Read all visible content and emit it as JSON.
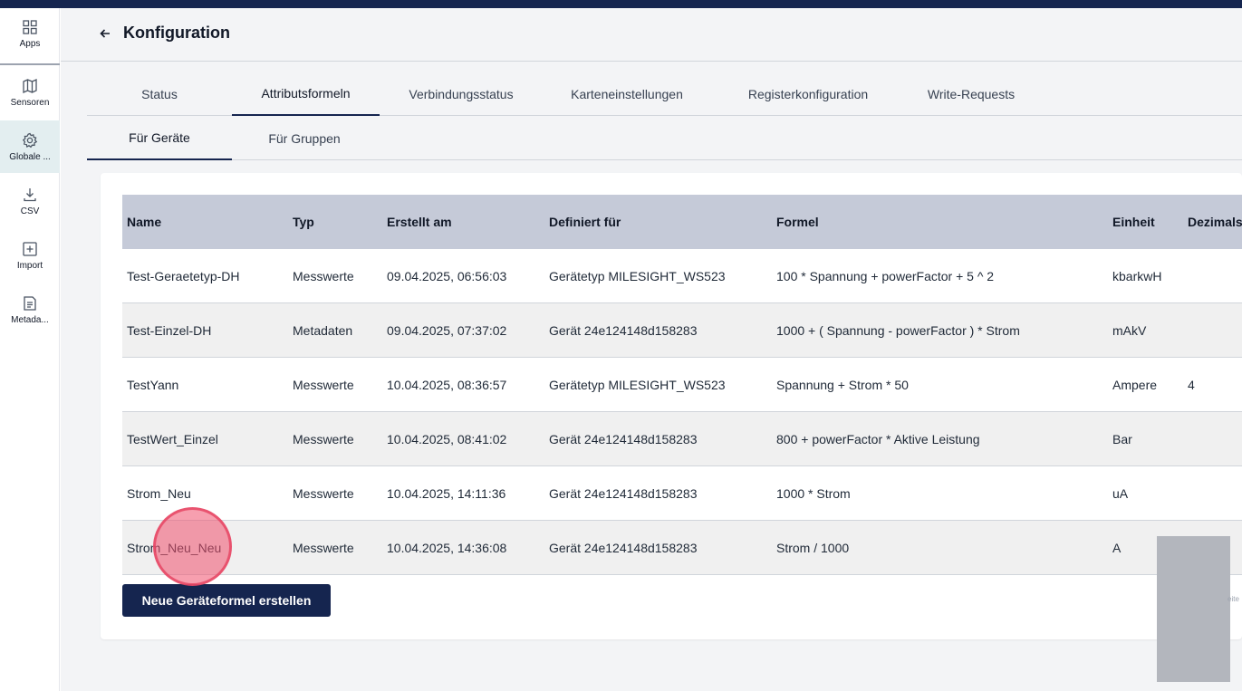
{
  "colors": {
    "brand": "#15254f",
    "table_header": "#c5cad8",
    "active_sidebar": "#e3eef0"
  },
  "sidebar": {
    "items": [
      {
        "label": "Apps",
        "icon": "grid-icon"
      },
      {
        "label": "Sensoren",
        "icon": "map-icon"
      },
      {
        "label": "Globale ...",
        "icon": "gear-icon"
      },
      {
        "label": "CSV",
        "icon": "download-icon"
      },
      {
        "label": "Import",
        "icon": "plus-square-icon"
      },
      {
        "label": "Metada...",
        "icon": "document-icon"
      }
    ]
  },
  "header": {
    "title": "Konfiguration"
  },
  "tabs": [
    "Status",
    "Attributsformeln",
    "Verbindungsstatus",
    "Karteneinstellungen",
    "Registerkonfiguration",
    "Write-Requests"
  ],
  "active_tab": "Attributsformeln",
  "subtabs": [
    "Für Geräte",
    "Für Gruppen"
  ],
  "active_subtab": "Für Geräte",
  "table": {
    "columns": [
      "Name",
      "Typ",
      "Erstellt am",
      "Definiert für",
      "Formel",
      "Einheit",
      "Dezimals"
    ],
    "rows": [
      [
        "Test-Geraetetyp-DH",
        "Messwerte",
        "09.04.2025, 06:56:03",
        "Gerätetyp MILESIGHT_WS523",
        "100 * Spannung + powerFactor + 5 ^ 2",
        "kbarkwH",
        ""
      ],
      [
        "Test-Einzel-DH",
        "Metadaten",
        "09.04.2025, 07:37:02",
        "Gerät 24e124148d158283",
        "1000 + ( Spannung - powerFactor ) * Strom",
        "mAkV",
        ""
      ],
      [
        "TestYann",
        "Messwerte",
        "10.04.2025, 08:36:57",
        "Gerätetyp MILESIGHT_WS523",
        "Spannung + Strom * 50",
        "Ampere",
        "4"
      ],
      [
        "TestWert_Einzel",
        "Messwerte",
        "10.04.2025, 08:41:02",
        "Gerät 24e124148d158283",
        "800 + powerFactor * Aktive Leistung",
        "Bar",
        ""
      ],
      [
        "Strom_Neu",
        "Messwerte",
        "10.04.2025, 14:11:36",
        "Gerät 24e124148d158283",
        "1000 * Strom",
        "uA",
        ""
      ],
      [
        "Strom_Neu_Neu",
        "Messwerte",
        "10.04.2025, 14:36:08",
        "Gerät 24e124148d158283",
        "Strom / 1000",
        "A",
        ""
      ]
    ]
  },
  "create_button": "Neue Geräteformel erstellen",
  "pager_hint": "eite"
}
